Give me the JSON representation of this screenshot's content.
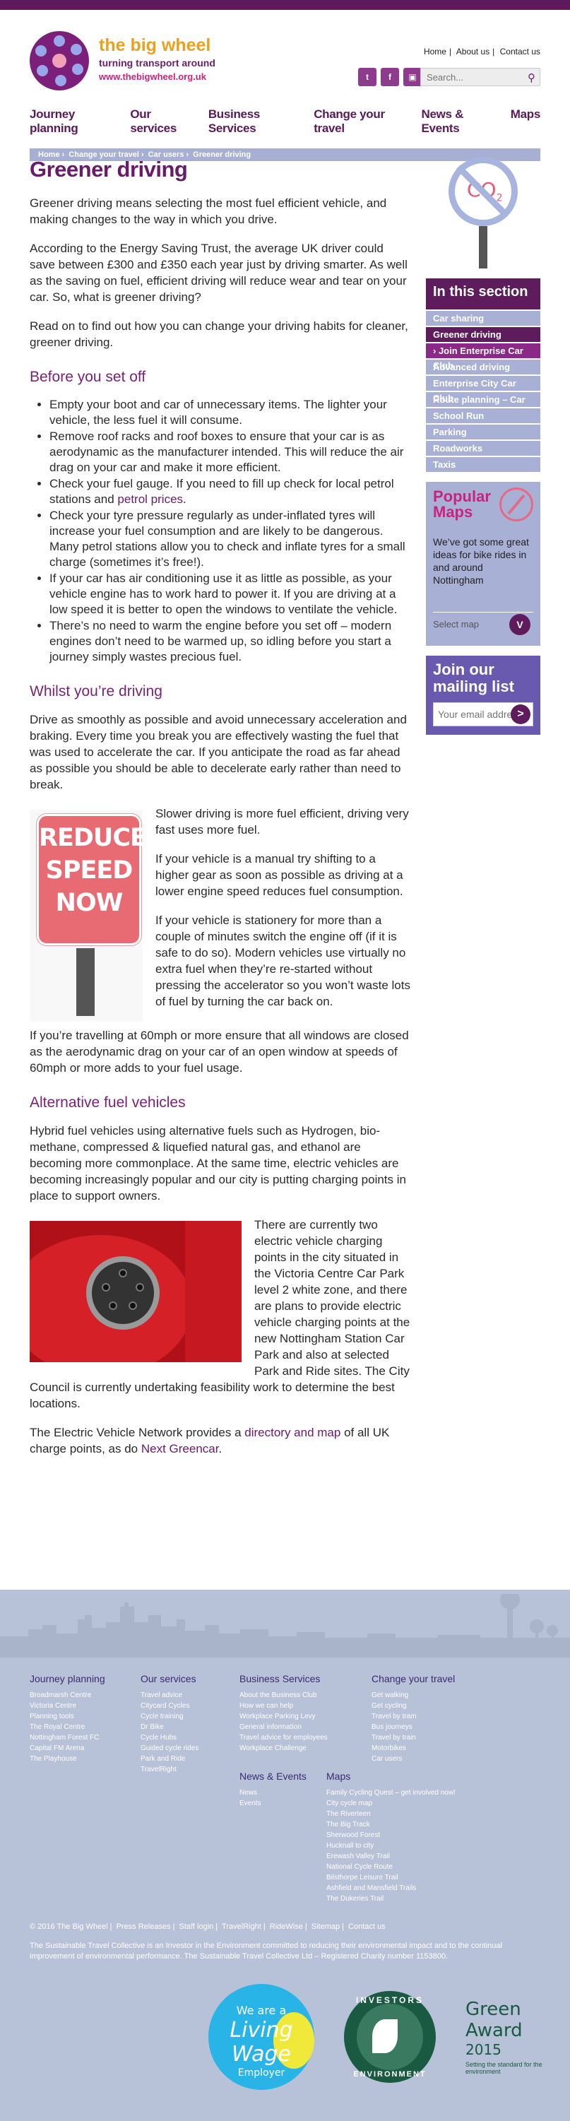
{
  "brand": {
    "name": "the big wheel",
    "tagline": "turning transport around",
    "url": "www.thebigwheel.org.uk"
  },
  "toplinks": [
    "Home",
    "About us",
    "Contact us"
  ],
  "search": {
    "placeholder": "Search..."
  },
  "social": [
    "twitter-icon",
    "facebook-icon",
    "flickr-icon"
  ],
  "nav": [
    "Journey planning",
    "Our services",
    "Business Services",
    "Change your travel",
    "News & Events",
    "Maps"
  ],
  "breadcrumb": [
    "Home",
    "Change your travel",
    "Car users",
    "Greener driving"
  ],
  "page": {
    "title": "Greener driving",
    "intro1": "Greener driving means selecting the most fuel efficient vehicle, and making changes to the way in which you drive.",
    "intro2": "According to the Energy Saving Trust, the average UK driver could save between £300 and £350 each year just by driving smarter. As well as the saving on fuel, efficient driving will reduce wear and tear on your car. So, what is greener driving?",
    "intro3": "Read on to find out how you can change your driving habits for cleaner, greener driving.",
    "before_heading": "Before you set off",
    "before_items": [
      "Empty your boot and car of unnecessary items. The lighter your vehicle, the less fuel it will consume.",
      "Remove roof racks and roof boxes to ensure that your car is as aerodynamic as the manufacturer intended. This will reduce the air drag on your car and make it more efficient.",
      "Check your fuel gauge. If you need to fill up check for local petrol stations and",
      "Check your tyre pressure regularly as under-inflated tyres will increase your fuel consumption and are likely to be dangerous. Many petrol stations allow you to check and inflate tyres for a small charge (sometimes it’s free!).",
      "If your car has air conditioning use it as little as possible, as your vehicle engine has to work hard to power it. If you are driving at a low speed it is better to open the windows to ventilate the vehicle.",
      "There’s no need to warm the engine before you set off – modern engines don’t need to be warmed up, so idling before you start a journey simply wastes precious fuel."
    ],
    "petrol_link": "petrol prices",
    "whilst_heading": "Whilst you’re driving",
    "whilst_p1": "Drive as smoothly as possible and avoid unnecessary acceleration and braking. Every time you break you are effectively wasting the fuel that was used to accelerate the car. If you anticipate the road as far ahead as possible you should be able to decelerate early rather than need to break.",
    "sign_text": "REDUCE SPEED NOW",
    "whilst_p2": "Slower driving is more fuel efficient, driving very fast uses more fuel.",
    "whilst_p3": "If your vehicle is a manual try shifting to a higher gear as soon as possible as driving at a lower engine speed reduces fuel consumption.",
    "whilst_p4": "If your vehicle is stationery for more than a couple of minutes switch the engine off (if it is safe to do so). Modern vehicles use virtually no extra fuel when they’re re-started without pressing the accelerator so you won’t waste lots of fuel by turning the car back on.",
    "whilst_p5": "If you’re travelling at 60mph or more ensure that all windows are closed as the aerodynamic drag on your car of an open window at speeds of 60mph or more adds to your fuel usage.",
    "alt_heading": "Alternative fuel vehicles",
    "alt_p1": "Hybrid fuel vehicles using alternative fuels such as Hydrogen, bio-methane, compressed & liquefied natural gas, and ethanol are becoming more commonplace. At the same time, electric vehicles are becoming increasingly popular and our city is putting charging points in place to support owners.",
    "alt_p2": "There are currently two electric vehicle charging points in the city situated in the Victoria Centre Car Park level 2 white zone, and there are plans to provide electric vehicle charging points at the new Nottingham Station Car Park and also at selected Park and Ride sites. The City Council is currently undertaking feasibility work to determine the best locations.",
    "alt_p3_before": "The Electric Vehicle Network provides a",
    "alt_p3_link1": "directory and map",
    "alt_p3_middle": "of all UK charge points, as do",
    "alt_p3_link2": "Next Greencar"
  },
  "sidebar": {
    "co2_label": "CO",
    "co2_sub": "2",
    "section_title": "In this section",
    "items": [
      "Car sharing",
      "Greener driving",
      "› Join Enterprise Car Club",
      "Advanced driving",
      "Enterprise City Car Club",
      "Route planning – Car",
      "School Run",
      "Parking",
      "Roadworks",
      "Taxis"
    ],
    "popular_title": "Popular Maps",
    "popular_desc": "We’ve got some great ideas for bike rides in and around Nottingham",
    "select_map": "Select map",
    "select_go": "V",
    "mailing_title": "Join our mailing list",
    "email_placeholder": "Your email address",
    "mailing_go": ">"
  },
  "footer": {
    "journey": {
      "title": "Journey planning",
      "links": [
        "Broadmarsh Centre",
        "Victoria Centre",
        "Planning tools",
        "The Royal Centre",
        "Nottingham Forest FC",
        "Capital FM Arena",
        "The Playhouse"
      ]
    },
    "services": {
      "title": "Our services",
      "links": [
        "Travel advice",
        "Citycard Cycles",
        "Cycle training",
        "Dr Bike",
        "Cycle Hubs",
        "Guided cycle rides",
        "Park and Ride",
        "TravelRight"
      ]
    },
    "business": {
      "title": "Business Services",
      "links": [
        "About the Business Club",
        "How we can help",
        "Workplace Parking Levy",
        "General information",
        "Travel advice for employees",
        "Workplace Challenge"
      ]
    },
    "news": {
      "title": "News & Events",
      "links": [
        "News",
        "Events"
      ]
    },
    "change": {
      "title": "Change your travel",
      "links": [
        "Get walking",
        "Get cycling",
        "Travel by tram",
        "Bus journeys",
        "Travel by train",
        "Motorbikes",
        "Car users"
      ]
    },
    "maps": {
      "title": "Maps",
      "links": [
        "Family Cycling Quest – get involved now!",
        "City cycle map",
        "The Riverteen",
        "The Big Track",
        "Sherwood Forest",
        "Hucknall to city",
        "Erewash Valley Trail",
        "National Cycle Route",
        "Bilsthorpe Leisure Trail",
        "Ashfield and Mansfield Trails",
        "The Dukeries Trail"
      ]
    },
    "legal_links": [
      "© 2016 The Big Wheel",
      "Press Releases",
      "Staff login",
      "TravelRight",
      "RideWise",
      "Sitemap",
      "Contact us"
    ],
    "legal_text": "The Sustainable Travel Collective is an Investor in the Environment committed to reducing their environmental impact and to the continual improvement of environmental performance. The Sustainable Travel Collective Ltd – Registered Charity number 1153800.",
    "living_wage": [
      "We are a",
      "Living",
      "Wage",
      "Employer"
    ],
    "iie_top": "INVESTORS",
    "iie_bottom": "ENVIRONMENT",
    "green_award": [
      "Green Award",
      "2015",
      "Setting the standard for the environment"
    ]
  }
}
